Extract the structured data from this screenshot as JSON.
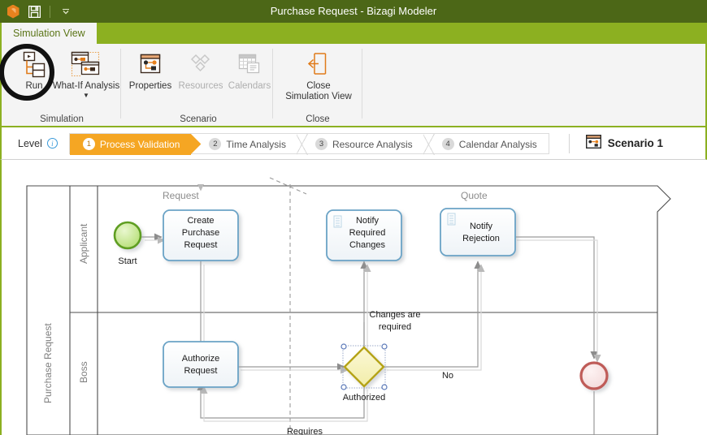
{
  "window": {
    "title": "Purchase Request - Bizagi Modeler",
    "quick_access": [
      {
        "name": "bizagi-logo-icon",
        "label": "Bizagi"
      },
      {
        "name": "save-icon",
        "label": "Save"
      },
      {
        "name": "chevron-down-icon",
        "label": "Customize Quick Access Toolbar"
      }
    ]
  },
  "tabs": [
    {
      "label": "Simulation View",
      "active": true
    }
  ],
  "ribbon": {
    "groups": [
      {
        "title": "Simulation",
        "buttons": [
          {
            "label": "Run",
            "icon": "run-icon",
            "enabled": true,
            "has_menu": false,
            "highlighted": true
          },
          {
            "label": "What-If Analysis",
            "icon": "what-if-analysis-icon",
            "enabled": true,
            "has_menu": true
          }
        ]
      },
      {
        "title": "Scenario",
        "buttons": [
          {
            "label": "Properties",
            "icon": "properties-icon",
            "enabled": true,
            "has_menu": false
          },
          {
            "label": "Resources",
            "icon": "resources-icon",
            "enabled": false,
            "has_menu": false
          },
          {
            "label": "Calendars",
            "icon": "calendars-icon",
            "enabled": false,
            "has_menu": false
          }
        ]
      },
      {
        "title": "Close",
        "buttons": [
          {
            "label": "Close\nSimulation View",
            "label_line1": "Close",
            "label_line2": "Simulation View",
            "icon": "close-simulation-view-icon",
            "enabled": true,
            "has_menu": false
          }
        ]
      }
    ]
  },
  "levelbar": {
    "label": "Level",
    "info_icon": "info-icon",
    "levels": [
      {
        "num": "1",
        "label": "Process Validation",
        "active": true
      },
      {
        "num": "2",
        "label": "Time Analysis",
        "active": false
      },
      {
        "num": "3",
        "label": "Resource Analysis",
        "active": false
      },
      {
        "num": "4",
        "label": "Calendar Analysis",
        "active": false
      }
    ],
    "scenario": {
      "icon": "scenario-icon",
      "name": "Scenario 1"
    }
  },
  "diagram": {
    "pool_label": "Purchase Request",
    "lanes": [
      {
        "label": "Applicant"
      },
      {
        "label": "Boss"
      }
    ],
    "nodes": [
      {
        "id": "start",
        "type": "start-event",
        "label": "Start"
      },
      {
        "id": "create_purchase_request",
        "type": "task",
        "label_lines": [
          "Create",
          "Purchase",
          "Request"
        ]
      },
      {
        "id": "notify_required_changes",
        "type": "task",
        "label_lines": [
          "Notify",
          "Required",
          "Changes"
        ],
        "marker": "script"
      },
      {
        "id": "notify_rejection",
        "type": "task",
        "label_lines": [
          "Notify",
          "Rejection"
        ],
        "marker": "script"
      },
      {
        "id": "authorize_request",
        "type": "task",
        "label_lines": [
          "Authorize",
          "Request"
        ]
      },
      {
        "id": "authorized",
        "type": "exclusive-gateway",
        "label": "Authorized",
        "selected": true
      },
      {
        "id": "end",
        "type": "end-event",
        "label": ""
      }
    ],
    "flow_labels": [
      {
        "id": "changes_are_required",
        "lines": [
          "Changes are",
          "required"
        ]
      },
      {
        "id": "no",
        "lines": [
          "No"
        ]
      },
      {
        "id": "requires",
        "lines": [
          "Requires"
        ]
      }
    ],
    "message_labels": [
      {
        "id": "request",
        "label": "Request"
      },
      {
        "id": "quote",
        "label": "Quote"
      }
    ]
  },
  "colors": {
    "titlebar": "#4c6717",
    "tabstrip": "#8cb021",
    "ribbon_bg": "#f4f4f4",
    "accent_orange": "#f5a623",
    "task_border": "#6ba3c6",
    "start_event": "#8dc63f",
    "end_event": "#c0504d",
    "gateway": "#b5a317"
  }
}
